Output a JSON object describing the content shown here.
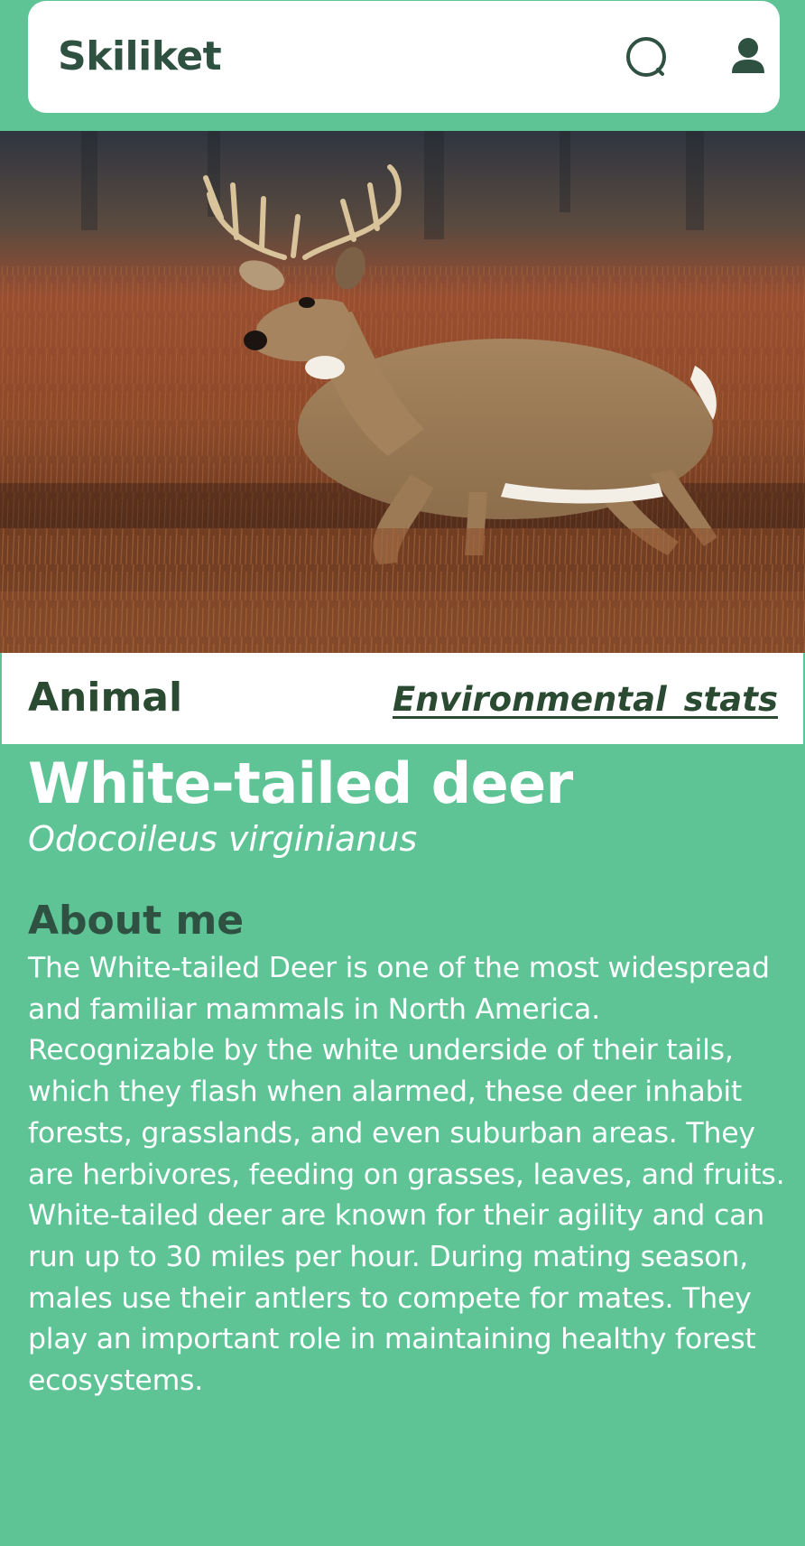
{
  "header": {
    "app_title": "Skiliket",
    "search_icon": "search-icon",
    "profile_icon": "user-icon"
  },
  "hero": {
    "image": "white-tailed deer buck walking through reddish meadow grass"
  },
  "tabs": {
    "active": "Animal",
    "link": "Environmental  stats"
  },
  "species": {
    "common_name": "White-tailed deer",
    "scientific_name": "Odocoileus virginianus"
  },
  "about": {
    "heading": "About me",
    "text": "The White-tailed Deer is one of the most widespread and familiar mammals in North America. Recognizable by the white underside of their tails, which they flash when alarmed, these deer inhabit forests, grasslands, and even suburban areas. They are herbivores, feeding on grasses, leaves, and fruits. White-tailed deer are known for their agility and can run up to 30 miles per hour. During mating season, males use their antlers to compete for mates. They play an important role in maintaining healthy forest ecosystems."
  },
  "colors": {
    "background": "#5ec496",
    "dark_green": "#2f5142",
    "card": "#ffffff"
  }
}
